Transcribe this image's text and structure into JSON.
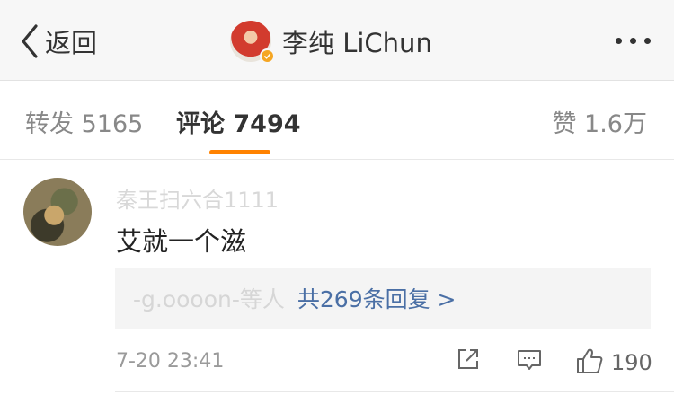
{
  "header": {
    "back_label": "返回",
    "title": "李纯 LiChun"
  },
  "tabs": {
    "repost": "转发 5165",
    "comment": "评论 7494",
    "like": "赞 1.6万"
  },
  "comment": {
    "username": "秦王扫六合1111",
    "text": "艾就一个滋",
    "reply_users": "-g.oooon-等人",
    "reply_count": "共269条回复 >",
    "timestamp": "7-20 23:41",
    "like_count": "190"
  },
  "colors": {
    "accent": "#ff8200",
    "link": "#4a6fa5",
    "verified": "#f5a623"
  },
  "icons": [
    "chevron-left-icon",
    "verified-icon",
    "more-icon",
    "share-icon",
    "reply-icon",
    "thumbs-up-icon"
  ]
}
